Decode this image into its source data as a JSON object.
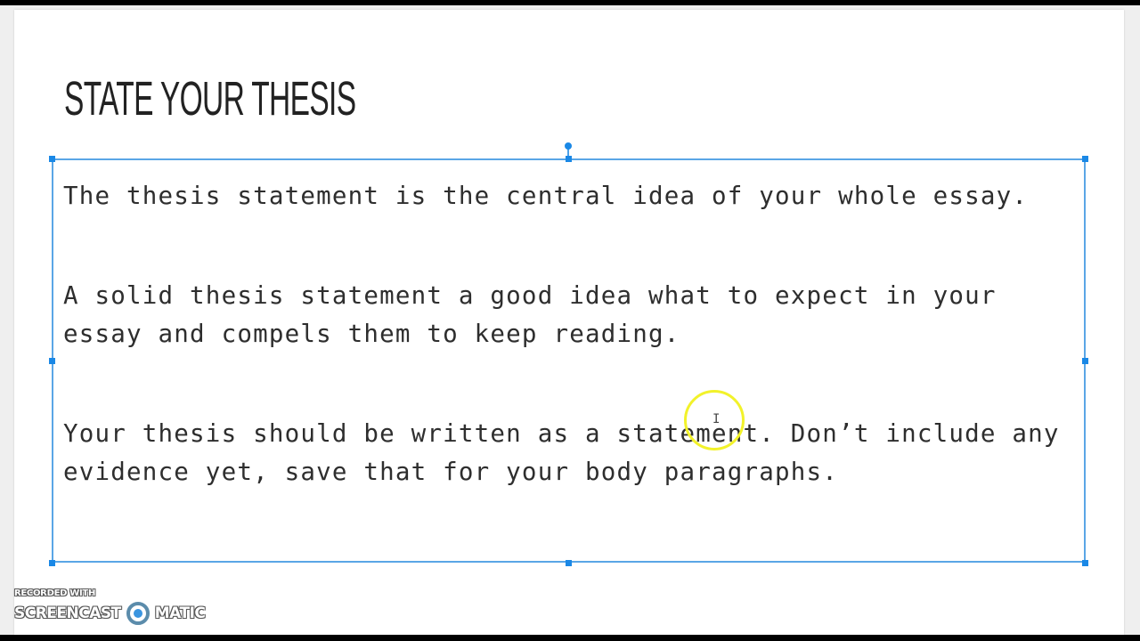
{
  "slide": {
    "title": "STATE YOUR THESIS",
    "paragraphs": [
      "The thesis statement is the central idea of your whole essay.",
      "A solid thesis statement a good idea what to expect in your essay and compels them to keep reading.",
      "Your thesis should be written as a statement. Don’t include any evidence yet, save that for your body paragraphs."
    ]
  },
  "selection": {
    "color": "#1a88e6"
  },
  "cursor": {
    "highlight_color": "#f2f22a",
    "glyph": "I"
  },
  "watermark": {
    "line1": "RECORDED WITH",
    "left_word": "SCREENCAST",
    "right_word": "MATIC"
  }
}
